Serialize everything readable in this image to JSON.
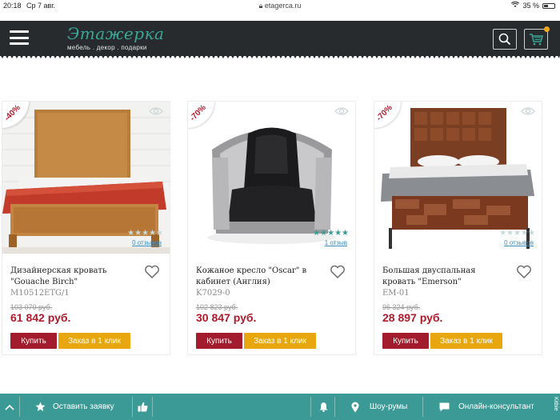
{
  "status_bar": {
    "time": "20:18",
    "date": "Ср 7 авг.",
    "url": "etagerca.ru",
    "battery": "35 %",
    "battery_level": 0.35
  },
  "header": {
    "logo_title": "Этажерка",
    "logo_subtitle": "мебель . декор . подарки",
    "cart_badge_color": "#f0a81c"
  },
  "products": [
    {
      "discount": "-40%",
      "name": "Дизайнерская кровать \"Gouache Birch\"",
      "sku": "M10512ETG/1",
      "reviews": "0 отзывов",
      "rating": 0,
      "old_price": "103 070 руб.",
      "price": "61 842 руб.",
      "buy_label": "Купить",
      "quick_label": "Заказ в 1 клик"
    },
    {
      "discount": "-70%",
      "name": "Кожаное кресло \"Oscar\" в кабинет (Англия)",
      "sku": "K7029-0",
      "reviews": "1 отзыв",
      "rating": 5,
      "old_price": "102 823 руб.",
      "price": "30 847 руб.",
      "buy_label": "Купить",
      "quick_label": "Заказ в 1 клик"
    },
    {
      "discount": "-70%",
      "name": "Большая двуспальная кровать \"Emerson\"",
      "sku": "EM-01",
      "reviews": "0 отзывов",
      "rating": 0,
      "old_price": "96 324 руб.",
      "price": "28 897 руб.",
      "buy_label": "Купить",
      "quick_label": "Заказ в 1 клик"
    }
  ],
  "bottom_bar": {
    "leave_request": "Оставить заявку",
    "showrooms": "Шоу-румы",
    "consultant": "Онлайн-консультант",
    "brand": "Kitbie"
  },
  "colors": {
    "accent_teal": "#3b9a95",
    "price_red": "#b11a2b",
    "buy_red": "#a31c2d",
    "quick_orange": "#e9a70f",
    "header_dark": "#272b2e"
  }
}
